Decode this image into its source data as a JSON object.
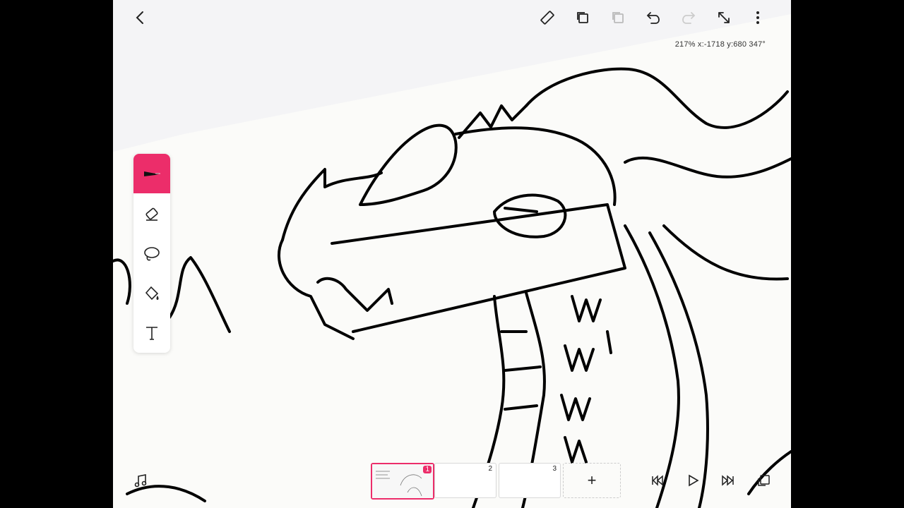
{
  "app": {
    "accent": "#ec2d6a",
    "background": "#f4f4f6",
    "paper": "#fbfbf9"
  },
  "toolbar": {
    "icons": [
      "back-icon",
      "ruler-icon",
      "duplicate-icon",
      "copy-icon",
      "undo-icon",
      "redo-icon",
      "resize-icon",
      "more-icon"
    ],
    "redo_enabled": false,
    "copy_enabled": false
  },
  "readout": {
    "text": "217% x:-1718 y:680 347°"
  },
  "tools": {
    "items": [
      "pen-tool",
      "eraser-tool",
      "lasso-tool",
      "fill-tool",
      "text-tool"
    ],
    "selected": "pen-tool"
  },
  "timeline": {
    "frames": [
      {
        "number": "1",
        "active": true
      },
      {
        "number": "2",
        "active": false
      },
      {
        "number": "3",
        "active": false
      }
    ],
    "add_label": "+"
  },
  "playback": {
    "icons": [
      "music-icon",
      "rewind-icon",
      "play-icon",
      "skip-end-icon",
      "layers-icon"
    ]
  }
}
